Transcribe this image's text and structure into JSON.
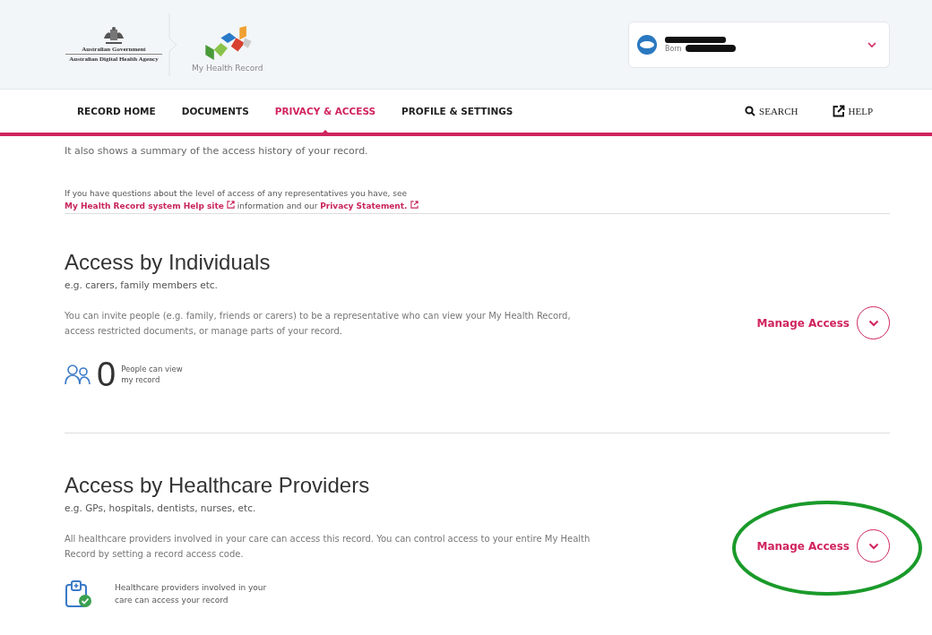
{
  "header": {
    "gov_logo": {
      "line_1": "Australian Government",
      "line_2": "Australian Digital Health Agency"
    },
    "brand": "My Health Record",
    "profile": {
      "born_label": "Born"
    }
  },
  "nav": {
    "tabs": [
      {
        "label": "RECORD HOME",
        "selected": false
      },
      {
        "label": "DOCUMENTS",
        "selected": false
      },
      {
        "label": "PRIVACY & ACCESS",
        "selected": true
      },
      {
        "label": "PROFILE & SETTINGS",
        "selected": false
      }
    ],
    "search": "SEARCH",
    "help": "HELP"
  },
  "intro": {
    "text": "It also shows a summary of the access history of your record.",
    "questions": "If you have questions about the level of access of any representatives you have, see",
    "help_link": "My Health Record system Help site",
    "middle": "information and our",
    "privacy_link": "Privacy Statement."
  },
  "sections": [
    {
      "kind": "individuals",
      "title": "Access by Individuals",
      "subtitle": "e.g. carers, family members etc.",
      "description": "You can invite people (e.g. family, friends or carers) to be a representative who can view your My Health Record, access restricted documents, or manage parts of your record.",
      "action": "Manage Access",
      "count": "0",
      "stat": "People can view my record",
      "highlighted": false
    },
    {
      "kind": "providers",
      "title": "Access by Healthcare Providers",
      "subtitle": "e.g. GPs, hospitals, dentists, nurses, etc.",
      "description": "All healthcare providers involved in your care can access this record. You can control access to your entire My Health Record by setting a record access code.",
      "action": "Manage Access",
      "stat": "Healthcare providers involved in your care can access your record",
      "highlighted": true
    }
  ]
}
